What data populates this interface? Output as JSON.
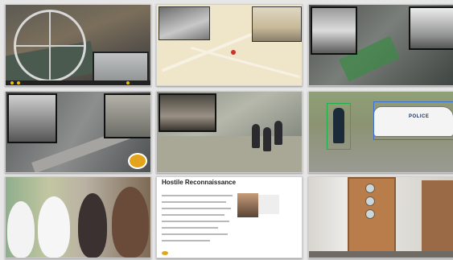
{
  "gallery": {
    "tiles": [
      {
        "name": "ferris-wheel-aerial-tile"
      },
      {
        "name": "map-tracking-tile"
      },
      {
        "name": "street-aerial-insets-tile"
      },
      {
        "name": "intersection-aerial-tile"
      },
      {
        "name": "lobby-cctv-tile"
      },
      {
        "name": "police-car-detection-tile"
      },
      {
        "name": "crowd-tile"
      },
      {
        "name": "hostile-reconnaissance-doc-tile"
      },
      {
        "name": "hallway-door-tile"
      }
    ],
    "document": {
      "title": "Hostile Reconnaissance",
      "police_text": "POLICE"
    }
  }
}
